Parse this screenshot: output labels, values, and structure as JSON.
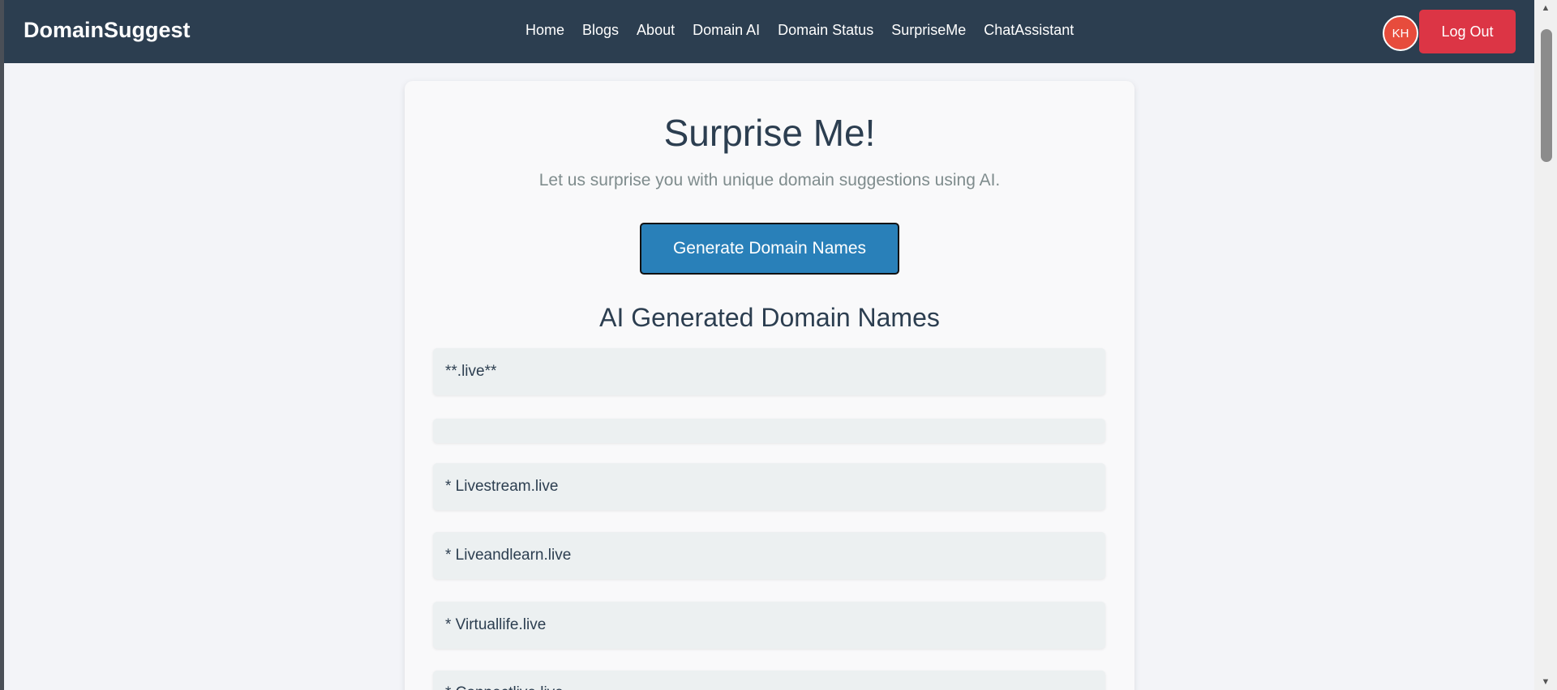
{
  "navbar": {
    "brand": "DomainSuggest",
    "links": [
      "Home",
      "Blogs",
      "About",
      "Domain AI",
      "Domain Status",
      "SurpriseMe",
      "ChatAssistant"
    ],
    "avatar_initials": "KH",
    "logout_label": "Log Out"
  },
  "main": {
    "title": "Surprise Me!",
    "subtitle": "Let us surprise you with unique domain suggestions using AI.",
    "generate_label": "Generate Domain Names",
    "results_heading": "AI Generated Domain Names",
    "results": [
      "**.live**",
      "",
      "* Livestream.live",
      "* Liveandlearn.live",
      "* Virtuallife.live",
      "* Connectlive.live"
    ]
  },
  "colors": {
    "navbar_bg": "#2c3e50",
    "accent_blue": "#2980b9",
    "logout_red": "#dc3545",
    "avatar_red": "#e74c3c"
  }
}
